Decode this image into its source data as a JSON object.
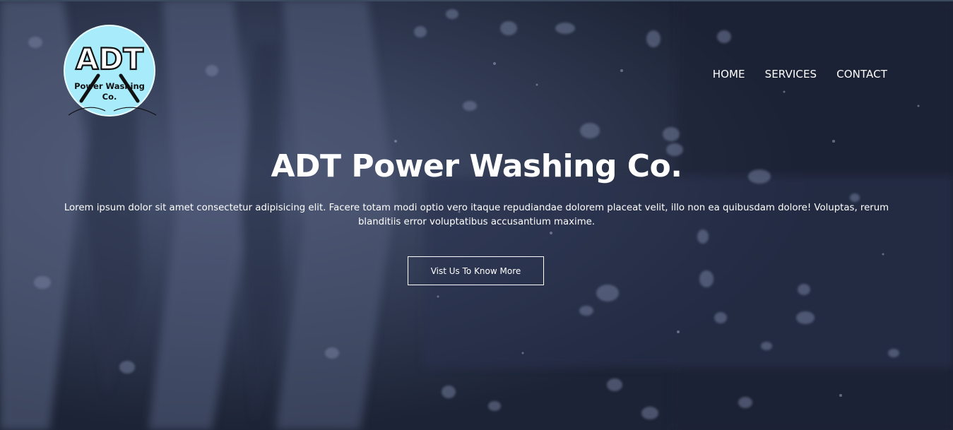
{
  "logo": {
    "big_text": "ADT",
    "line1": "Power Washing",
    "line2": "Co."
  },
  "nav": {
    "items": [
      "HOME",
      "SERVICES",
      "CONTACT"
    ]
  },
  "hero": {
    "title": "ADT Power Washing Co.",
    "text": "Lorem ipsum dolor sit amet consectetur adipisicing elit. Facere totam modi optio vero itaque repudiandae dolorem placeat velit, illo non ea quibusdam dolore! Voluptas, rerum blanditiis error voluptatibus accusantium maxime.",
    "button_label": "Vist Us To Know More"
  },
  "colors": {
    "overlay": "#1b2236",
    "logo_circle": "#a8ecfb",
    "text": "#ffffff"
  }
}
